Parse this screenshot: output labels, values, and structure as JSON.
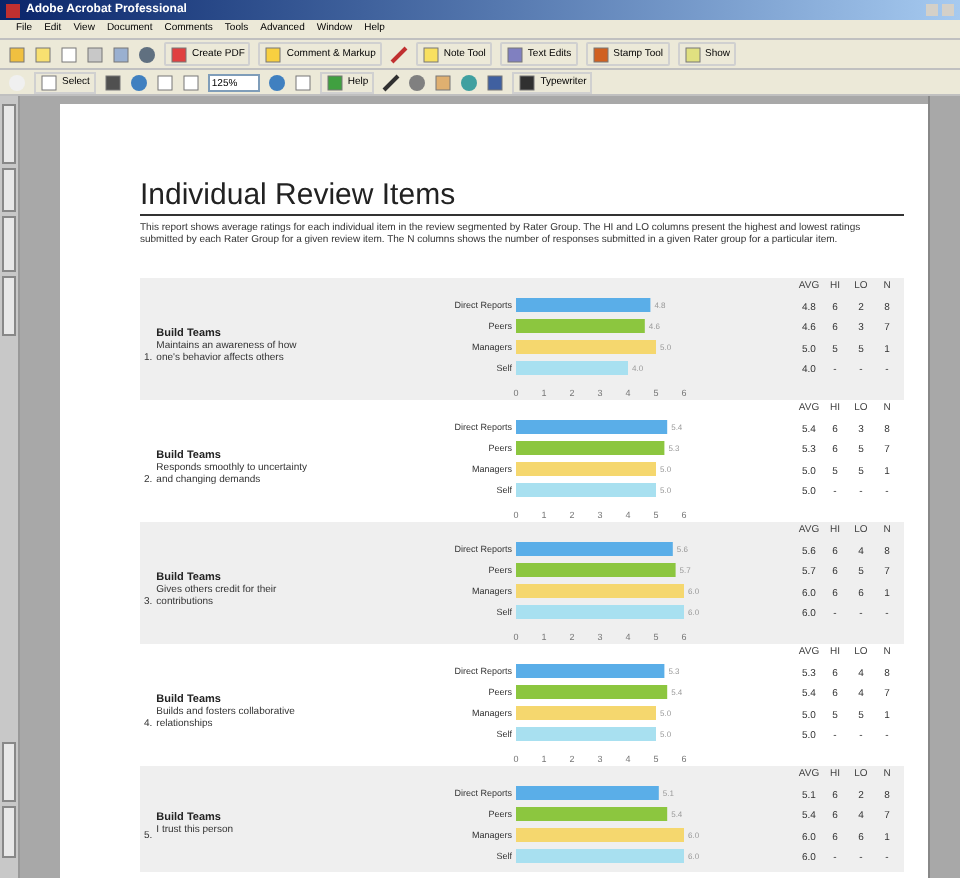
{
  "window": {
    "title": "Adobe Acrobat Professional"
  },
  "menu": [
    "File",
    "Edit",
    "View",
    "Document",
    "Comments",
    "Tools",
    "Advanced",
    "Window",
    "Help"
  ],
  "toolbar_1": {
    "buttons": [
      "Create PDF",
      "Comment & Markup",
      "Note Tool",
      "Text Edits",
      "Stamp Tool",
      "Show"
    ]
  },
  "toolbar_2": {
    "buttons": [
      "Select",
      "Help",
      "Typewriter"
    ],
    "zoom": "125%"
  },
  "report": {
    "title": "Individual Review Items",
    "intro": "This report shows average ratings for each individual item in the review segmented by Rater Group. The HI and LO columns present the highest and lowest ratings submitted by each Rater Group for a given review item. The N columns shows the number of responses submitted in a given Rater group for a particular item.",
    "items": [
      {
        "number": "1.",
        "category": "Build Teams",
        "statement": "Maintains an awareness of how one's behavior affects others",
        "columns": [
          "AVG",
          "HI",
          "LO",
          "N"
        ],
        "rows": [
          [
            "4.8",
            "6",
            "2",
            "8"
          ],
          [
            "4.6",
            "6",
            "3",
            "7"
          ],
          [
            "5.0",
            "5",
            "5",
            "1"
          ],
          [
            "4.0",
            "-",
            "-",
            "-"
          ]
        ],
        "chart_data": {
          "type": "bar",
          "orientation": "horizontal",
          "categories": [
            "Direct Reports",
            "Peers",
            "Managers",
            "Self"
          ],
          "values": [
            4.8,
            4.6,
            5.0,
            4.0
          ],
          "colors": [
            "#5aaee8",
            "#8cc63f",
            "#f5d76e",
            "#a8e0f0"
          ],
          "xlim": [
            0,
            6
          ],
          "xticks": [
            0,
            1,
            2,
            3,
            4,
            5,
            6
          ],
          "value_labels": [
            "4.8",
            "4.6",
            "5.0",
            "4.0"
          ]
        }
      },
      {
        "number": "2.",
        "category": "Build Teams",
        "statement": "Responds smoothly to uncertainty and changing demands",
        "columns": [
          "AVG",
          "HI",
          "LO",
          "N"
        ],
        "rows": [
          [
            "5.4",
            "6",
            "3",
            "8"
          ],
          [
            "5.3",
            "6",
            "5",
            "7"
          ],
          [
            "5.0",
            "5",
            "5",
            "1"
          ],
          [
            "5.0",
            "-",
            "-",
            "-"
          ]
        ],
        "chart_data": {
          "type": "bar",
          "orientation": "horizontal",
          "categories": [
            "Direct Reports",
            "Peers",
            "Managers",
            "Self"
          ],
          "values": [
            5.4,
            5.3,
            5.0,
            5.0
          ],
          "colors": [
            "#5aaee8",
            "#8cc63f",
            "#f5d76e",
            "#a8e0f0"
          ],
          "xlim": [
            0,
            6
          ],
          "xticks": [
            0,
            1,
            2,
            3,
            4,
            5,
            6
          ],
          "value_labels": [
            "5.4",
            "5.3",
            "5.0",
            "5.0"
          ]
        }
      },
      {
        "number": "3.",
        "category": "Build Teams",
        "statement": "Gives others credit for their contributions",
        "columns": [
          "AVG",
          "HI",
          "LO",
          "N"
        ],
        "rows": [
          [
            "5.6",
            "6",
            "4",
            "8"
          ],
          [
            "5.7",
            "6",
            "5",
            "7"
          ],
          [
            "6.0",
            "6",
            "6",
            "1"
          ],
          [
            "6.0",
            "-",
            "-",
            "-"
          ]
        ],
        "chart_data": {
          "type": "bar",
          "orientation": "horizontal",
          "categories": [
            "Direct Reports",
            "Peers",
            "Managers",
            "Self"
          ],
          "values": [
            5.6,
            5.7,
            6.0,
            6.0
          ],
          "colors": [
            "#5aaee8",
            "#8cc63f",
            "#f5d76e",
            "#a8e0f0"
          ],
          "xlim": [
            0,
            6
          ],
          "xticks": [
            0,
            1,
            2,
            3,
            4,
            5,
            6
          ],
          "value_labels": [
            "5.6",
            "5.7",
            "6.0",
            "6.0"
          ]
        }
      },
      {
        "number": "4.",
        "category": "Build Teams",
        "statement": "Builds and fosters collaborative relationships",
        "columns": [
          "AVG",
          "HI",
          "LO",
          "N"
        ],
        "rows": [
          [
            "5.3",
            "6",
            "4",
            "8"
          ],
          [
            "5.4",
            "6",
            "4",
            "7"
          ],
          [
            "5.0",
            "5",
            "5",
            "1"
          ],
          [
            "5.0",
            "-",
            "-",
            "-"
          ]
        ],
        "chart_data": {
          "type": "bar",
          "orientation": "horizontal",
          "categories": [
            "Direct Reports",
            "Peers",
            "Managers",
            "Self"
          ],
          "values": [
            5.3,
            5.4,
            5.0,
            5.0
          ],
          "colors": [
            "#5aaee8",
            "#8cc63f",
            "#f5d76e",
            "#a8e0f0"
          ],
          "xlim": [
            0,
            6
          ],
          "xticks": [
            0,
            1,
            2,
            3,
            4,
            5,
            6
          ],
          "value_labels": [
            "5.3",
            "5.4",
            "5.0",
            "5.0"
          ]
        }
      },
      {
        "number": "5.",
        "category": "Build Teams",
        "statement": "I trust this person",
        "columns": [
          "AVG",
          "HI",
          "LO",
          "N"
        ],
        "rows": [
          [
            "5.1",
            "6",
            "2",
            "8"
          ],
          [
            "5.4",
            "6",
            "4",
            "7"
          ],
          [
            "6.0",
            "6",
            "6",
            "1"
          ],
          [
            "6.0",
            "-",
            "-",
            "-"
          ]
        ],
        "chart_data": {
          "type": "bar",
          "orientation": "horizontal",
          "categories": [
            "Direct Reports",
            "Peers",
            "Managers",
            "Self"
          ],
          "values": [
            5.1,
            5.4,
            6.0,
            6.0
          ],
          "colors": [
            "#5aaee8",
            "#8cc63f",
            "#f5d76e",
            "#a8e0f0"
          ],
          "value_labels": [
            "5.1",
            "5.4",
            "6.0",
            "6.0"
          ]
        }
      }
    ]
  }
}
